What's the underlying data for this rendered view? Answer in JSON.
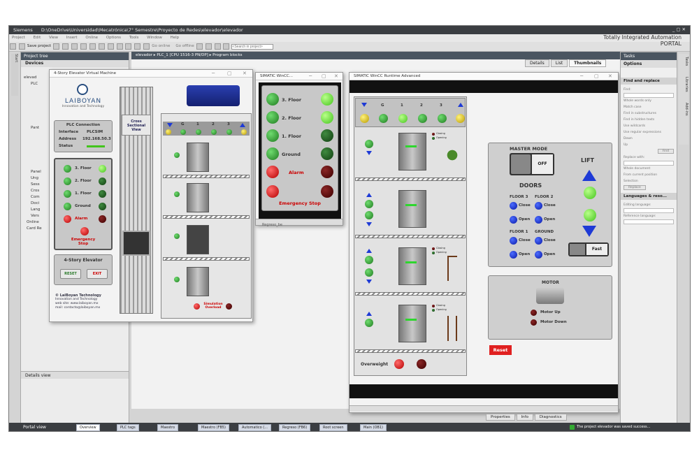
{
  "titlebar": {
    "app": "Siemens",
    "path": "D:\\OneDrive\\Universidad\\Mecatrónica\\7° Semestre\\Proyecto de Redes\\elevador\\elevador"
  },
  "menu": [
    "Project",
    "Edit",
    "View",
    "Insert",
    "Online",
    "Options",
    "Tools",
    "Window",
    "Help"
  ],
  "toolbar": {
    "save_label": "Save project",
    "go_online": "Go online",
    "go_offline": "Go offline",
    "search_placeholder": "<Search in project>"
  },
  "brand": {
    "line1": "Totally Integrated Automation",
    "line2": "PORTAL"
  },
  "project_tree": {
    "title": "Project tree",
    "devices_tab": "Devices",
    "rows": [
      "elevad",
      "PLC",
      "",
      "",
      "",
      "",
      "",
      "",
      "Pant",
      "",
      "",
      "",
      "",
      "",
      "",
      "Panel",
      "Ung",
      "Sess",
      "Cros",
      "Com",
      "Doci",
      "Lang",
      "Vers",
      "Online",
      "Card Re"
    ]
  },
  "details_view": {
    "title": "Details view"
  },
  "breadcrumb": {
    "items": [
      "elevador",
      "PLC_1 [CPU 1516-3 PN/DP]",
      "Program blocks"
    ]
  },
  "view_tabs": [
    "Details",
    "List",
    "Thumbnails"
  ],
  "vm": {
    "title": "4-Story Elevator Virtual Machine",
    "logo": "LAIBOYAN",
    "logo_sub": "Innovation and Technology",
    "plc_title": "PLC Connection",
    "interface_label": "Interface",
    "interface_value": "PLCSIM",
    "address_label": "Address",
    "address_value": "192.168.50.3",
    "status_label": "Status",
    "floors": [
      "3. Floor",
      "2. Floor",
      "1. Floor",
      "Ground",
      "Alarm"
    ],
    "emergency": "Emergency Stop",
    "elevator_title": "4-Story Elevator",
    "reset": "RESET",
    "exit": "EXIT",
    "company": "© LaiBoyan Technology",
    "company_sub": "Innovation and Technology",
    "web": "web site:  www.laiboyan.mx",
    "mail": "mail: contacto@laiboyan.mx",
    "cross_section": "Cross Sectional View",
    "top_labels": [
      "G",
      "1",
      "2",
      "3"
    ],
    "overload": "Simulation Overload"
  },
  "winccA": {
    "title": "SIMATIC WinCC...",
    "floors": [
      "3. Floor",
      "2. Floor",
      "1. Floor",
      "Ground",
      "Alarm"
    ],
    "emergency": "Emergency Stop",
    "behind_text": "Regreso_be"
  },
  "winccB": {
    "title": "SIMATIC WinCC Runtime Advanced",
    "top_labels": [
      "G",
      "1",
      "2",
      "3"
    ],
    "closing": "Closing",
    "opening": "Opening",
    "overweight": "Overweight",
    "master_mode": "MASTER MODE",
    "off": "OFF",
    "lift": "LIFT",
    "doors": "DOORS",
    "floor3": "FLOOR 3",
    "floor2": "FLOOR 2",
    "floor1": "FLOOR 1",
    "ground": "GROUND",
    "close": "Close",
    "open": "Open",
    "fast": "Fast",
    "motor": "MOTOR",
    "motor_up": "Motor Up",
    "motor_down": "Motor Down",
    "reset": "Reset"
  },
  "right_panel": {
    "tasks": "Tasks",
    "options": "Options",
    "find_replace": "Find and replace",
    "find": "Find:",
    "whole_words": "Whole words only",
    "match_case": "Match case",
    "find_sub": "Find in substructures",
    "find_hidden": "Find in hidden texts",
    "wildcards": "Use wildcards",
    "regex": "Use regular expressions",
    "down": "Down",
    "up": "Up",
    "find_btn": "Find",
    "replace_with": "Replace with:",
    "whole_doc": "Whole document",
    "from_current": "From current position",
    "selection": "Selection",
    "replace_btn": "Replace",
    "languages": "Languages & reso...",
    "editing_lang": "Editing language:",
    "reference_lang": "Reference language:",
    "side_tabs": [
      "Tasks",
      "Libraries",
      "Add-ins"
    ]
  },
  "inspector_tabs": [
    "Properties",
    "Info",
    "Diagnostics"
  ],
  "status": {
    "portal_view": "Portal view",
    "tabs": [
      "Overview",
      "PLC tags",
      "Maestro",
      "Maestro (FB5)",
      "Automatico (...",
      "Regreso (FB6)",
      "Root screen",
      "Main (OB1)"
    ],
    "message": "The project elevador was saved success..."
  }
}
